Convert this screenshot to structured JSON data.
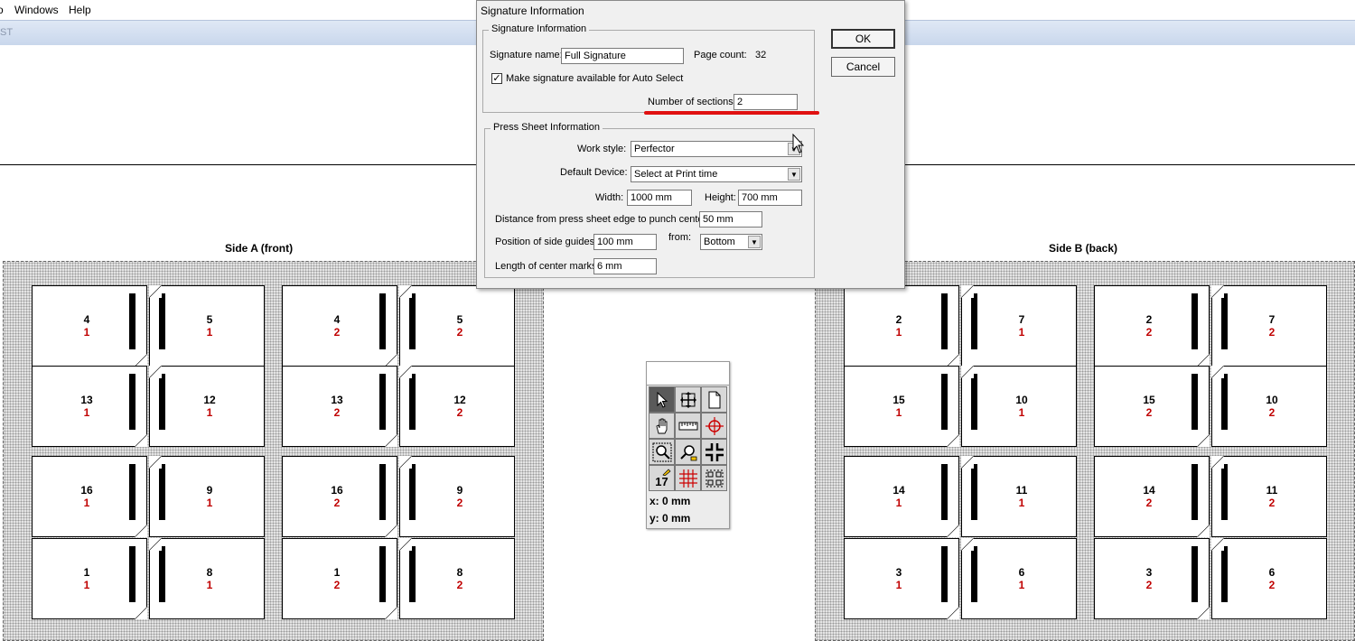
{
  "menubar": {
    "items": [
      "o",
      "Windows",
      "Help"
    ],
    "strip_text": "ST"
  },
  "sides": [
    {
      "title": "Side A (front)",
      "rows": [
        [
          [
            "4",
            "1"
          ],
          [
            "5",
            "1"
          ],
          [
            "4",
            "2"
          ],
          [
            "5",
            "2"
          ]
        ],
        [
          [
            "13",
            "1"
          ],
          [
            "12",
            "1"
          ],
          [
            "13",
            "2"
          ],
          [
            "12",
            "2"
          ]
        ],
        [
          [
            "16",
            "1"
          ],
          [
            "9",
            "1"
          ],
          [
            "16",
            "2"
          ],
          [
            "9",
            "2"
          ]
        ],
        [
          [
            "1",
            "1"
          ],
          [
            "8",
            "1"
          ],
          [
            "1",
            "2"
          ],
          [
            "8",
            "2"
          ]
        ]
      ]
    },
    {
      "title": "Side B (back)",
      "rows": [
        [
          [
            "2",
            "1"
          ],
          [
            "7",
            "1"
          ],
          [
            "2",
            "2"
          ],
          [
            "7",
            "2"
          ]
        ],
        [
          [
            "15",
            "1"
          ],
          [
            "10",
            "1"
          ],
          [
            "15",
            "2"
          ],
          [
            "10",
            "2"
          ]
        ],
        [
          [
            "14",
            "1"
          ],
          [
            "11",
            "1"
          ],
          [
            "14",
            "2"
          ],
          [
            "11",
            "2"
          ]
        ],
        [
          [
            "3",
            "1"
          ],
          [
            "6",
            "1"
          ],
          [
            "3",
            "2"
          ],
          [
            "6",
            "2"
          ]
        ]
      ]
    }
  ],
  "palette": {
    "page_number_tool": "17",
    "x_readout": "x: 0 mm",
    "y_readout": "y: 0 mm",
    "icons": [
      "arrow-pointer-icon",
      "move-icon",
      "page-icon",
      "hand-icon",
      "ruler-icon",
      "registration-mark-icon",
      "zoom-in-icon",
      "zoom-out-icon",
      "crop-marks-icon",
      "page-number-icon",
      "grid-icon",
      "selection-icon"
    ]
  },
  "dialog": {
    "title": "Signature Information",
    "sig_group": "Signature Information",
    "sig_name_label": "Signature name:",
    "sig_name_value": "Full Signature",
    "page_count_label": "Page count:",
    "page_count_value": "32",
    "auto_select_label": "Make signature available for Auto Select",
    "auto_select_checked": "✓",
    "sections_label": "Number of sections:",
    "sections_value": "2",
    "press_group": "Press Sheet Information",
    "work_style_label": "Work style:",
    "work_style_value": "Perfector",
    "device_label": "Default Device:",
    "device_value": "Select at Print time",
    "width_label": "Width:",
    "width_value": "1000 mm",
    "height_label": "Height:",
    "height_value": "700 mm",
    "punch_label": "Distance from press sheet edge to punch center:",
    "punch_value": "50 mm",
    "side_guides_label": "Position of side guides:",
    "side_guides_value": "100 mm",
    "from_label": "from:",
    "from_value": "Bottom",
    "center_marks_label": "Length of center marks:",
    "center_marks_value": "6 mm",
    "ok_label": "OK",
    "cancel_label": "Cancel",
    "annotation_color": "#e01010"
  }
}
